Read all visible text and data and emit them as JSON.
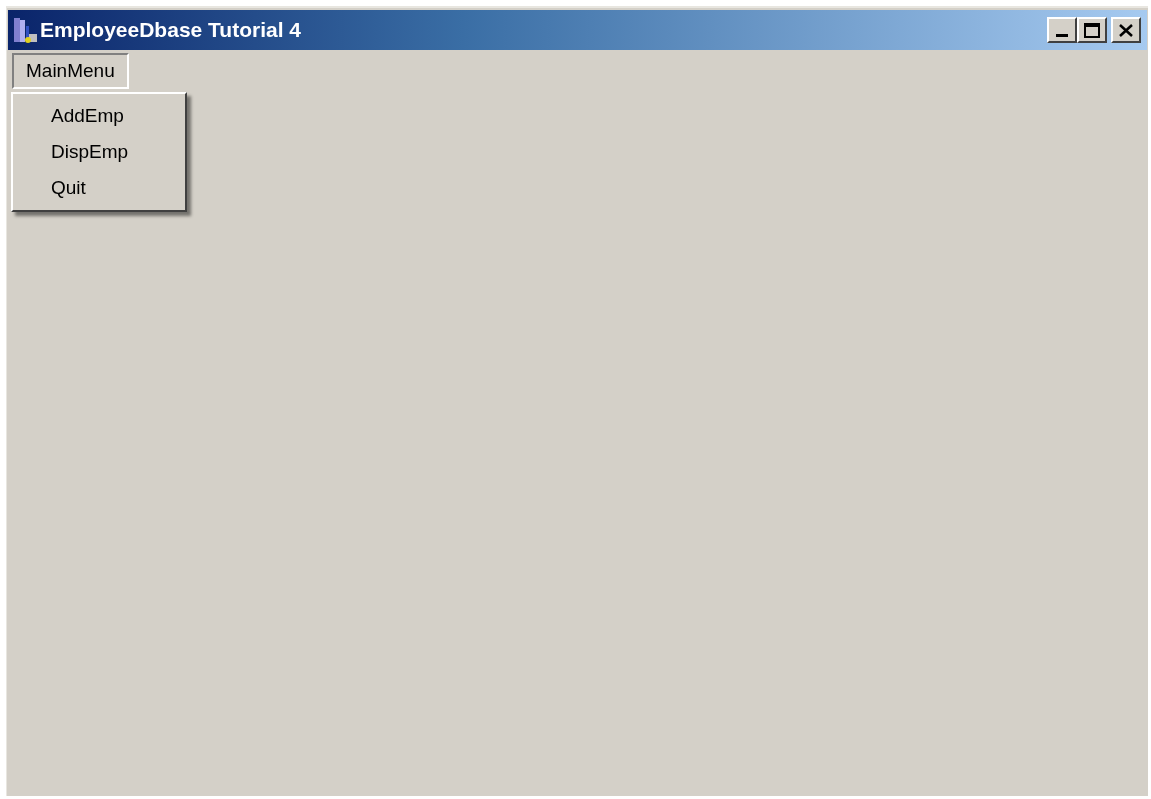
{
  "window": {
    "title": "EmployeeDbase Tutorial 4"
  },
  "menu": {
    "label": "MainMenu",
    "expanded": true,
    "items": [
      {
        "label": "AddEmp"
      },
      {
        "label": "DispEmp"
      },
      {
        "label": "Quit"
      }
    ]
  }
}
